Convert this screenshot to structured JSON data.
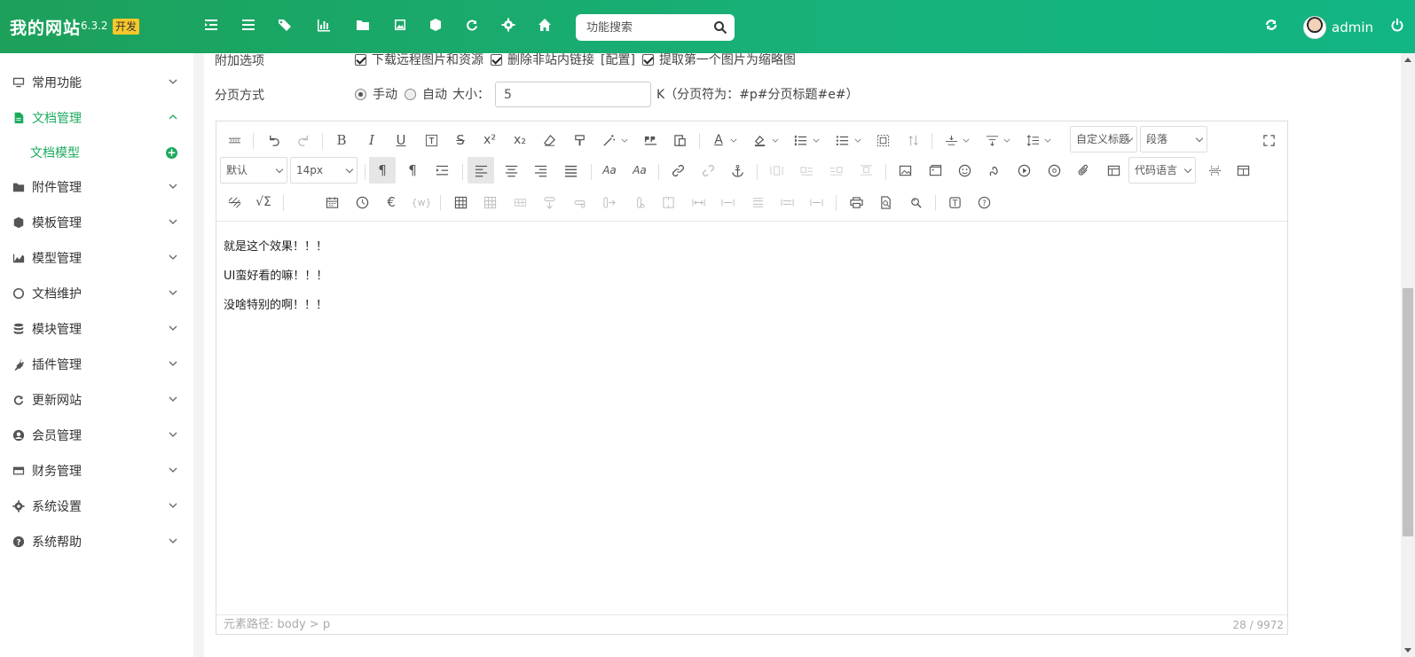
{
  "header": {
    "brand": "我的网站",
    "version": "6.3.2",
    "env_badge": "开发",
    "search_placeholder": "功能搜索",
    "username": "admin",
    "bg_color": "#17b27a"
  },
  "sidebar": {
    "items": [
      {
        "label": "常用功能",
        "icon": "desktop-icon"
      },
      {
        "label": "文档管理",
        "icon": "document-icon",
        "active": true
      },
      {
        "label": "附件管理",
        "icon": "folder-icon"
      },
      {
        "label": "模板管理",
        "icon": "cube-icon"
      },
      {
        "label": "模型管理",
        "icon": "area-chart-icon"
      },
      {
        "label": "文档维护",
        "icon": "circle-icon"
      },
      {
        "label": "模块管理",
        "icon": "database-icon"
      },
      {
        "label": "插件管理",
        "icon": "plug-icon"
      },
      {
        "label": "更新网站",
        "icon": "refresh-icon"
      },
      {
        "label": "会员管理",
        "icon": "user-circle-icon"
      },
      {
        "label": "财务管理",
        "icon": "credit-card-icon"
      },
      {
        "label": "系统设置",
        "icon": "gear-icon"
      },
      {
        "label": "系统帮助",
        "icon": "question-icon"
      }
    ],
    "sub_item": "文档模型"
  },
  "form": {
    "extra_options_label": "附加选项",
    "opt_download": "下载远程图片和资源",
    "opt_remove_links": "删除非站内链接",
    "opt_config": "[配置]",
    "opt_thumbnail": "提取第一个图片为缩略图",
    "paging_label": "分页方式",
    "paging_manual": "手动",
    "paging_auto": "自动",
    "size_label": "大小：",
    "size_value": "5",
    "paging_hint": "K（分页符为：#p#分页标题#e#）"
  },
  "editor": {
    "custom_title": "自定义标题",
    "paragraph": "段落",
    "font_family": "默认",
    "font_size": "14px",
    "code_lang": "代码语言",
    "lines": [
      "就是这个效果！！！",
      "UI蛮好看的嘛！！！",
      "没啥特别的啊！！！"
    ],
    "path": "元素路径: body > p",
    "count": "28 / 9972"
  }
}
